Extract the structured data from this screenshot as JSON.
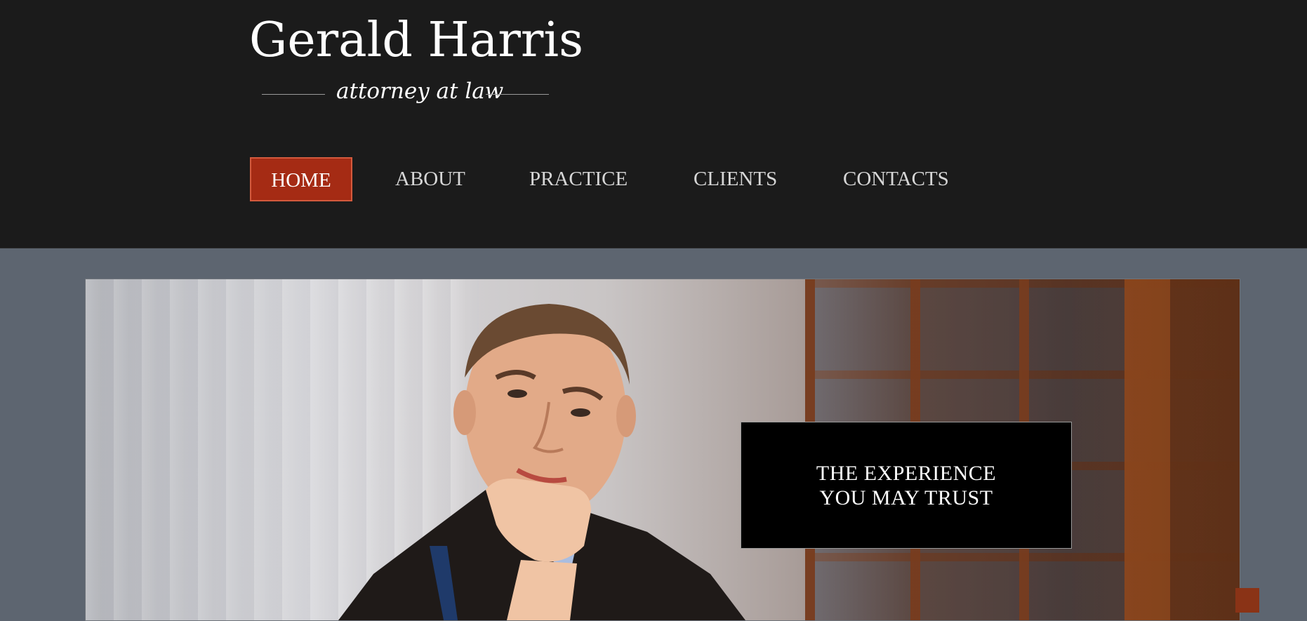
{
  "brand": {
    "name": "Gerald Harris",
    "tagline": "attorney at law"
  },
  "nav": {
    "items": [
      {
        "label": "HOME",
        "active": true
      },
      {
        "label": "ABOUT",
        "active": false
      },
      {
        "label": "PRACTICE",
        "active": false
      },
      {
        "label": "CLIENTS",
        "active": false
      },
      {
        "label": "CONTACTS",
        "active": false
      }
    ]
  },
  "hero": {
    "headline_line1": "THE EXPERIENCE",
    "headline_line2": "YOU MAY TRUST"
  },
  "colors": {
    "header_bg": "#1b1b1b",
    "page_bg": "#5d6570",
    "accent": "#a52b14",
    "nav_text": "#d6d6d6"
  }
}
